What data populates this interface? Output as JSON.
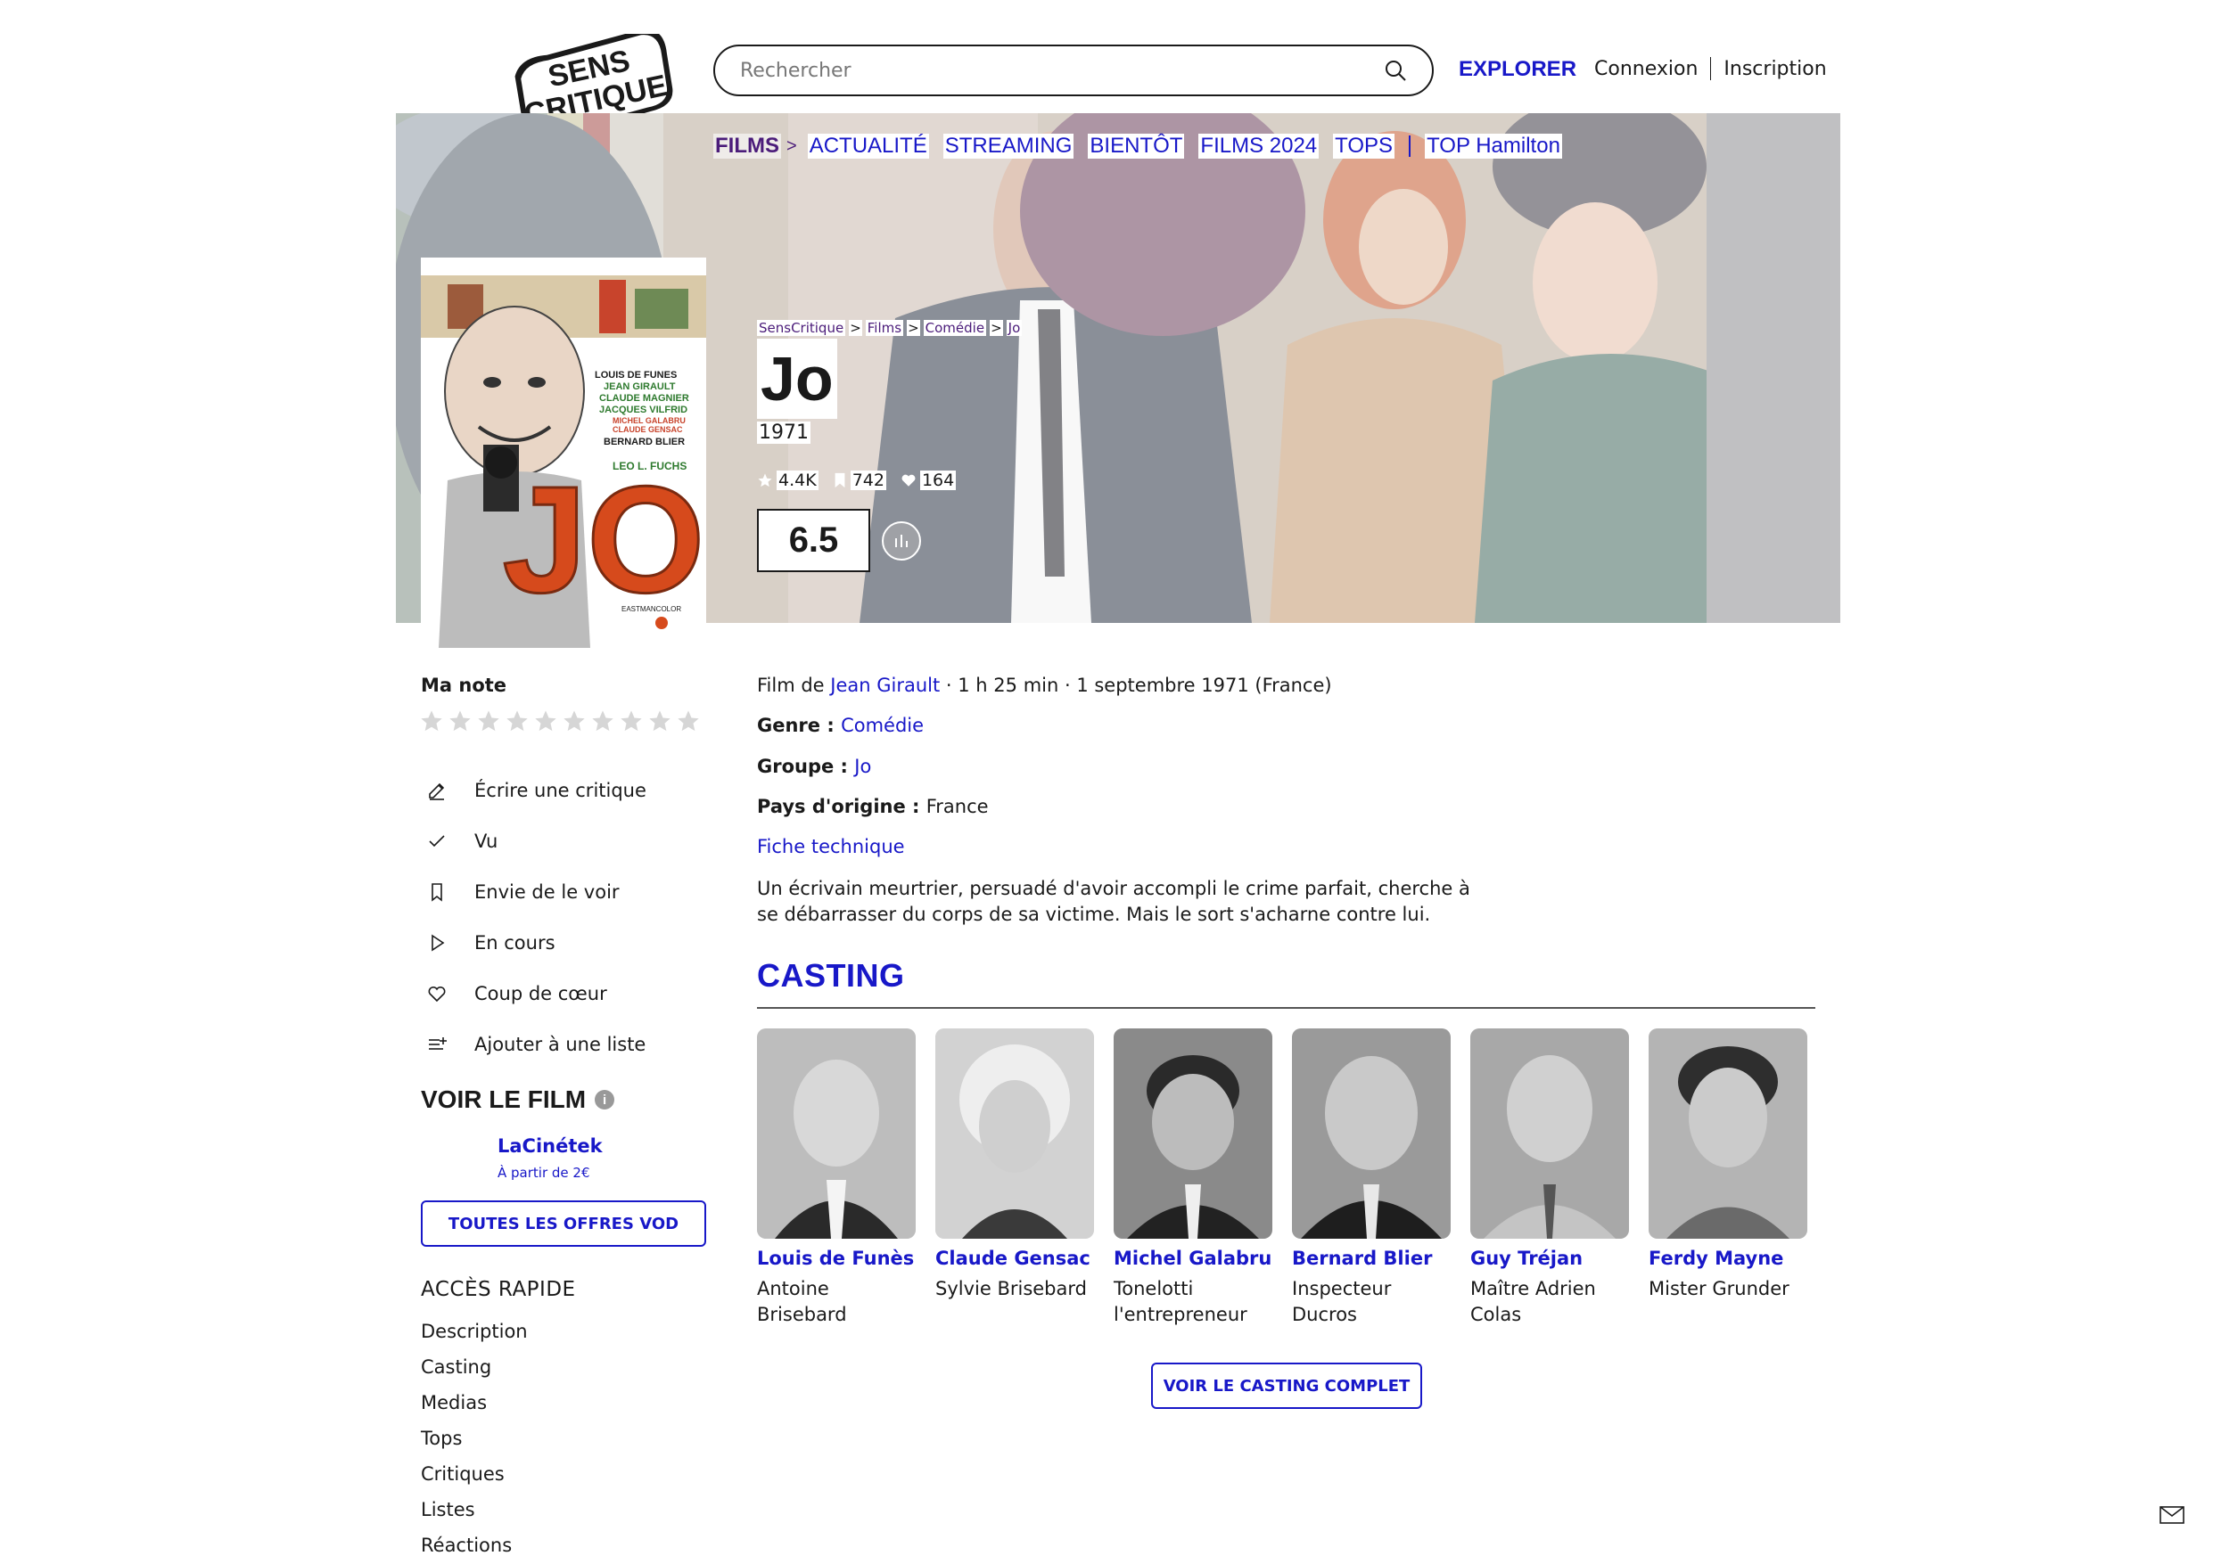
{
  "header": {
    "logo_text_top": "SENS",
    "logo_text_bottom": "CRITIQUE",
    "search_placeholder": "Rechercher",
    "explorer_label": "EXPLORER",
    "login_label": "Connexion",
    "signup_label": "Inscription"
  },
  "subnav": {
    "active": "FILMS",
    "items": [
      "ACTUALITÉ",
      "STREAMING",
      "BIENTÔT",
      "FILMS 2024",
      "TOPS"
    ],
    "extra": "TOP Hamilton"
  },
  "breadcrumb": [
    "SensCritique",
    "Films",
    "Comédie",
    "Jo"
  ],
  "film": {
    "title": "Jo",
    "year": "1971",
    "stats": {
      "ratings": "4.4K",
      "wishlist": "742",
      "favorites": "164"
    },
    "average_rating": "6.5",
    "director_prefix": "Film de ",
    "director": "Jean Girault",
    "details_rest": " · 1 h 25 min · 1 septembre 1971 (France)",
    "genre_label": "Genre : ",
    "genre": "Comédie",
    "group_label": "Groupe : ",
    "group": "Jo",
    "country_label": "Pays d'origine : ",
    "country": "France",
    "technical_sheet": "Fiche technique",
    "synopsis": "Un écrivain meurtrier, persuadé d'avoir accompli le crime parfait, cherche à se débarrasser du corps de sa victime. Mais le sort s'acharne contre lui."
  },
  "poster": {
    "credits": [
      "LOUIS DE FUNES",
      "JEAN GIRAULT",
      "CLAUDE MAGNIER",
      "JACQUES VILFRID",
      "MICHEL GALABRU",
      "CLAUDE GENSAC",
      "BERNARD BLIER",
      "LEO L. FUCHS"
    ],
    "big_title": "JO",
    "footer": "EASTMANCOLOR"
  },
  "my_rating": {
    "label": "Ma note",
    "max_stars": 10
  },
  "actions": [
    {
      "icon": "pencil-icon",
      "label": "Écrire une critique"
    },
    {
      "icon": "check-icon",
      "label": "Vu"
    },
    {
      "icon": "bookmark-icon",
      "label": "Envie de le voir"
    },
    {
      "icon": "play-icon",
      "label": "En cours"
    },
    {
      "icon": "heart-icon",
      "label": "Coup de cœur"
    },
    {
      "icon": "add-list-icon",
      "label": "Ajouter à une liste"
    }
  ],
  "watch": {
    "title": "VOIR LE FILM",
    "provider": "LaCinétek",
    "price": "À partir de 2€",
    "all_offers": "TOUTES LES OFFRES VOD"
  },
  "quick_access": {
    "title": "ACCÈS RAPIDE",
    "items": [
      "Description",
      "Casting",
      "Medias",
      "Tops",
      "Critiques",
      "Listes",
      "Réactions"
    ]
  },
  "casting": {
    "title": "CASTING",
    "members": [
      {
        "name": "Louis de Funès",
        "role": "Antoine Brisebard"
      },
      {
        "name": "Claude Gensac",
        "role": "Sylvie Brisebard"
      },
      {
        "name": "Michel Galabru",
        "role": "Tonelotti l'entrepreneur"
      },
      {
        "name": "Bernard Blier",
        "role": "Inspecteur Ducros"
      },
      {
        "name": "Guy Tréjan",
        "role": "Maître Adrien Colas"
      },
      {
        "name": "Ferdy Mayne",
        "role": "Mister Grunder"
      }
    ],
    "full_button": "VOIR LE CASTING COMPLET"
  },
  "colors": {
    "link_blue": "#1818c8",
    "films_purple": "#4b1c7a",
    "text": "#1a1a1a"
  }
}
